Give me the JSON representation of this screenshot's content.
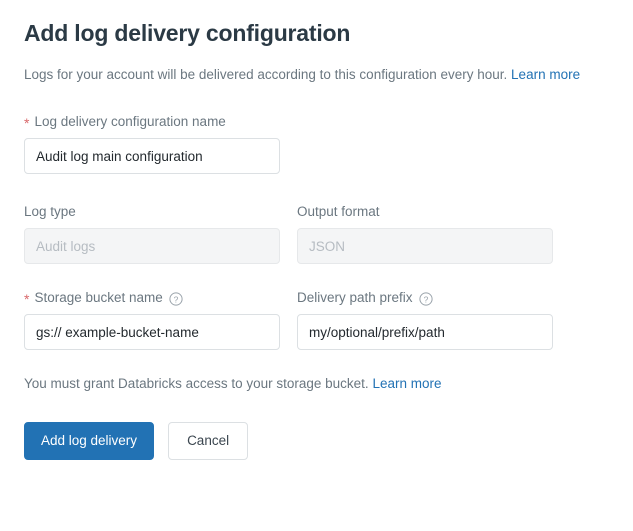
{
  "header": {
    "title": "Add log delivery configuration",
    "intro_text": "Logs for your account will be delivered according to this configuration every hour.",
    "intro_link": "Learn more"
  },
  "form": {
    "fields": [
      {
        "name": "log-delivery-configuration-name",
        "label": "Log delivery configuration name",
        "required": true,
        "required_marker": "*",
        "value": "Audit log main configuration",
        "placeholder": "",
        "disabled": false,
        "has_help_icon": false
      },
      {
        "name": "log-type",
        "label": "Log type",
        "required": false,
        "required_marker": "",
        "value": "",
        "placeholder": "Audit logs",
        "disabled": true,
        "has_help_icon": false
      },
      {
        "name": "output-format",
        "label": "Output format",
        "required": false,
        "required_marker": "",
        "value": "",
        "placeholder": "JSON",
        "disabled": true,
        "has_help_icon": false
      },
      {
        "name": "storage-bucket-name",
        "label": "Storage bucket name",
        "required": true,
        "required_marker": "*",
        "value": "gs:// example-bucket-name",
        "placeholder": "",
        "disabled": false,
        "has_help_icon": true,
        "help_icon": "help-circle-icon"
      },
      {
        "name": "delivery-path-prefix",
        "label": "Delivery path prefix",
        "required": false,
        "required_marker": "",
        "value": "my/optional/prefix/path",
        "placeholder": "",
        "disabled": false,
        "has_help_icon": true,
        "help_icon": "help-circle-icon"
      }
    ],
    "grant_note_text": "You must grant Databricks access to your storage bucket.",
    "grant_note_link": "Learn more"
  },
  "actions": {
    "submit_label": "Add log delivery",
    "cancel_label": "Cancel"
  },
  "colors": {
    "accent_blue": "#2272b4",
    "link_blue": "#2272b4",
    "required_red": "#d9686b",
    "label_grey": "#6b7780",
    "title_dark": "#2b3a45",
    "disabled_bg": "#f4f5f6",
    "border_grey": "#dce0e3"
  }
}
